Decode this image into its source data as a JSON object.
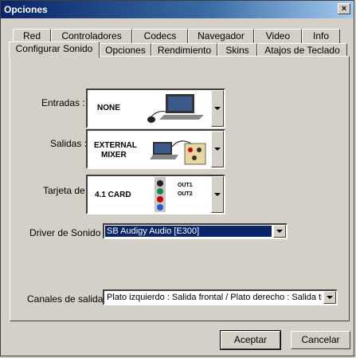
{
  "window": {
    "title": "Opciones",
    "close_glyph": "×"
  },
  "tabs_row1": [
    "Red",
    "Controladores",
    "Codecs",
    "Navegador",
    "Video",
    "Info"
  ],
  "tabs_row2": [
    "Configurar Sonido",
    "Opciones",
    "Rendimiento",
    "Skins",
    "Atajos de Teclado"
  ],
  "active_tab": "Configurar Sonido",
  "fields": {
    "entradas": {
      "label": "Entradas :",
      "value": "NONE"
    },
    "salidas": {
      "label": "Salidas :",
      "value_line1": "EXTERNAL",
      "value_line2": "MIXER"
    },
    "tarjeta": {
      "label": "Tarjeta de",
      "value": "4.1 CARD",
      "out1": "OUT1",
      "out2": "OUT2"
    },
    "driver": {
      "label": "Driver de Sonido :",
      "value": "SB Audigy Audio [E300]"
    },
    "canales": {
      "label": "Canales de salida :",
      "value": "Plato izquierdo : Salida frontal / Plato derecho : Salida trasera"
    }
  },
  "buttons": {
    "ok": "Aceptar",
    "cancel": "Cancelar"
  },
  "colors": {
    "titlebar": "#0a246a",
    "face": "#d4d0c8",
    "selection": "#0a246a"
  }
}
